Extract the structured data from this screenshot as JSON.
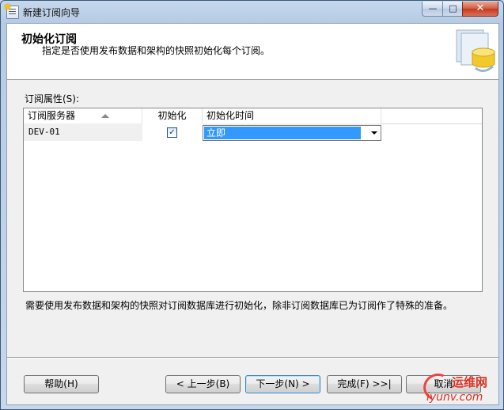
{
  "window": {
    "title": "新建订阅向导"
  },
  "caption_buttons": {
    "minimize": "—",
    "maximize": "□",
    "close": "✕"
  },
  "header": {
    "title": "初始化订阅",
    "subtitle": "指定是否使用发布数据和架构的快照初始化每个订阅。",
    "graphic_icon": "database-wizard-icon"
  },
  "grid": {
    "label": "订阅属性(S):",
    "columns": [
      "订阅服务器",
      "初始化",
      "初始化时间"
    ],
    "sort_indicator": "ascending",
    "rows": [
      {
        "server": "DEV-01",
        "initialize": true,
        "init_time": "立即"
      }
    ]
  },
  "note": "需要使用发布数据和架构的快照对订阅数据库进行初始化，除非订阅数据库已为订阅作了特殊的准备。",
  "buttons": {
    "help": "帮助(H)",
    "back": "< 上一步(B)",
    "next": "下一步(N) >",
    "finish": "完成(F) >>|",
    "cancel": "取消"
  },
  "watermark": {
    "top": "运维网",
    "bottom": "iyunv.com"
  },
  "colors": {
    "selection": "#3399ff",
    "title_bar": "#b6cbe3",
    "close_button": "#c23a1c"
  }
}
